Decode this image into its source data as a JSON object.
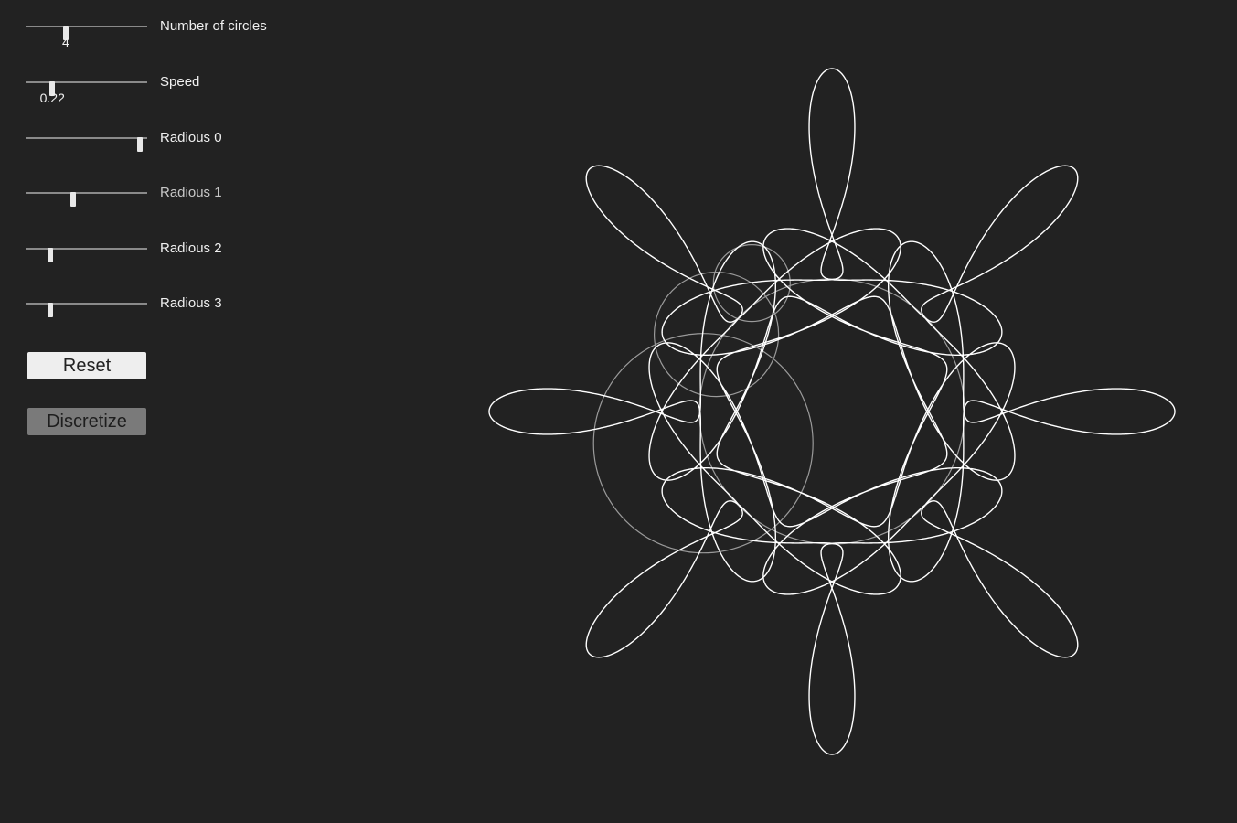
{
  "controls": {
    "circles": {
      "label": "Number of circles",
      "value": "4",
      "fraction": 0.33
    },
    "speed": {
      "label": "Speed",
      "value": "0.22",
      "fraction": 0.22
    },
    "radius0": {
      "label": "Radious 0",
      "fraction": 0.94
    },
    "radius1": {
      "label": "Radious 1",
      "fraction": 0.39
    },
    "radius2": {
      "label": "Radious 2",
      "fraction": 0.2
    },
    "radius3": {
      "label": "Radious 3",
      "fraction": 0.2
    }
  },
  "buttons": {
    "reset": "Reset",
    "discretize": "Discretize"
  },
  "colors": {
    "background": "#222222",
    "trace": "#ffffff",
    "epicycle": "#9a9a9a"
  }
}
